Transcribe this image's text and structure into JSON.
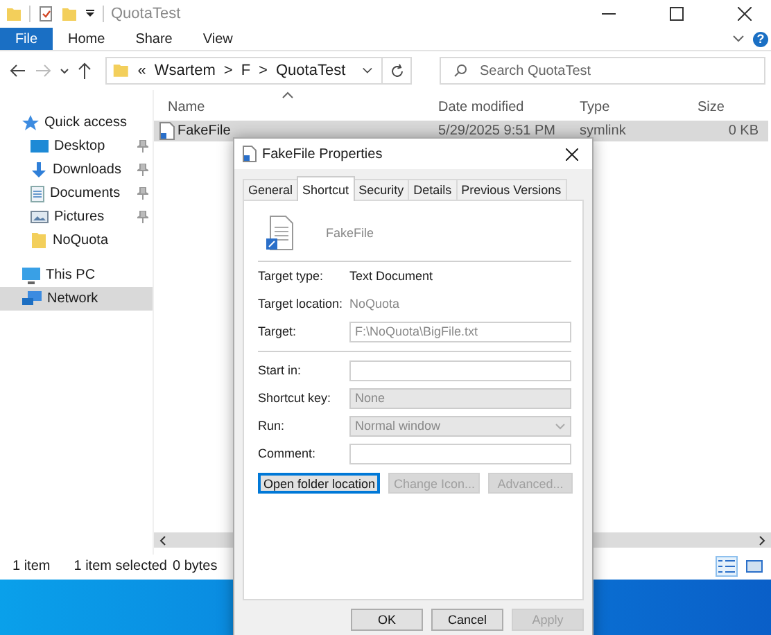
{
  "window": {
    "title": "QuotaTest"
  },
  "ribbon_tabs": [
    {
      "label": "File",
      "selected": true
    },
    {
      "label": "Home",
      "selected": false
    },
    {
      "label": "Share",
      "selected": false
    },
    {
      "label": "View",
      "selected": false
    }
  ],
  "help": "?",
  "address": {
    "overflow": "«",
    "separator": ">",
    "path": [
      "Wsartem",
      "F",
      "QuotaTest"
    ]
  },
  "search": {
    "placeholder": "Search QuotaTest"
  },
  "navigation": [
    {
      "label": "Quick access",
      "kind": "star",
      "pinned": false,
      "selected": false,
      "indent": false
    },
    {
      "label": "Desktop",
      "kind": "desktop",
      "pinned": true,
      "selected": false,
      "indent": true
    },
    {
      "label": "Downloads",
      "kind": "download",
      "pinned": true,
      "selected": false,
      "indent": true
    },
    {
      "label": "Documents",
      "kind": "document",
      "pinned": true,
      "selected": false,
      "indent": true
    },
    {
      "label": "Pictures",
      "kind": "pictures",
      "pinned": true,
      "selected": false,
      "indent": true
    },
    {
      "label": "NoQuota",
      "kind": "folder",
      "pinned": false,
      "selected": false,
      "indent": true
    },
    {
      "label": "This PC",
      "kind": "pc",
      "pinned": false,
      "selected": false,
      "indent": false
    },
    {
      "label": "Network",
      "kind": "network",
      "pinned": false,
      "selected": true,
      "indent": false
    }
  ],
  "columns": [
    "Name",
    "Date modified",
    "Type",
    "Size"
  ],
  "files": [
    {
      "name": "FakeFile",
      "date": "5/29/2025 9:51 PM",
      "type": "symlink",
      "size": "0 KB",
      "selected": true
    }
  ],
  "status_bar": {
    "count": "1 item",
    "selection": "1 item selected",
    "size": "0 bytes"
  },
  "views": [
    {
      "kind": "details",
      "selected": true
    },
    {
      "kind": "large",
      "selected": false
    }
  ],
  "dialog": {
    "title": "FakeFile Properties",
    "name": "FakeFile",
    "tabs": [
      {
        "label": "General",
        "selected": false
      },
      {
        "label": "Shortcut",
        "selected": true
      },
      {
        "label": "Security",
        "selected": false
      },
      {
        "label": "Details",
        "selected": false
      },
      {
        "label": "Previous Versions",
        "selected": false
      }
    ],
    "rows": [
      {
        "kind": "info",
        "label": "Target type:",
        "value": "Text Document",
        "dimmed": false
      },
      {
        "kind": "info",
        "label": "Target location:",
        "value": "NoQuota",
        "dimmed": true
      },
      {
        "kind": "field",
        "label": "Target:",
        "value": "F:\\NoQuota\\BigFile.txt",
        "dimmed": true,
        "disabled": false
      },
      {
        "kind": "separator"
      },
      {
        "kind": "field",
        "label": "Start in:",
        "disabled": false
      },
      {
        "kind": "field",
        "label": "Shortcut key:",
        "value": "None",
        "dimmed": true,
        "disabled": true
      },
      {
        "kind": "dropdown",
        "label": "Run:",
        "value": "Normal window",
        "dimmed": true,
        "disabled": true
      },
      {
        "kind": "field",
        "label": "Comment:",
        "disabled": false
      }
    ],
    "actions": [
      {
        "label": "Open folder location",
        "disabled": false,
        "focused": true
      },
      {
        "label": "Change Icon...",
        "disabled": true,
        "focused": false
      },
      {
        "label": "Advanced...",
        "disabled": true,
        "focused": false
      }
    ],
    "buttons": [
      {
        "label": "OK",
        "disabled": false
      },
      {
        "label": "Cancel",
        "disabled": false
      },
      {
        "label": "Apply",
        "disabled": true
      }
    ]
  }
}
